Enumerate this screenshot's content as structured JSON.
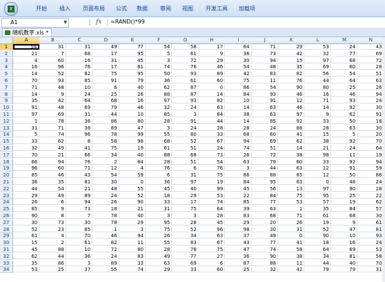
{
  "ribbon": {
    "office_logo": "X",
    "tabs": [
      "开始",
      "插入",
      "页面布局",
      "公式",
      "数据",
      "审阅",
      "视图",
      "开发工具",
      "加载项"
    ]
  },
  "formula_bar": {
    "name_box": "A1",
    "fx": "fx",
    "formula": "=RAND()*99"
  },
  "document": {
    "tab_label": "随机数字.xls *"
  },
  "grid": {
    "columns": [
      "A",
      "B",
      "C",
      "D",
      "E",
      "F",
      "G",
      "H",
      "I",
      "J",
      "K",
      "L",
      "M",
      "N"
    ],
    "rows": [
      [
        54,
        31,
        31,
        49,
        77,
        54,
        58,
        17,
        64,
        71,
        29,
        53,
        24,
        43
      ],
      [
        21,
        7,
        68,
        17,
        95,
        5,
        61,
        9,
        36,
        73,
        42,
        32,
        77,
        69
      ],
      [
        4,
        60,
        16,
        31,
        45,
        3,
        72,
        29,
        30,
        94,
        15,
        97,
        68,
        72
      ],
      [
        16,
        96,
        76,
        17,
        61,
        74,
        76,
        46,
        54,
        48,
        35,
        69,
        60,
        28
      ],
      [
        14,
        52,
        82,
        75,
        95,
        50,
        93,
        89,
        42,
        83,
        82,
        56,
        54,
        51
      ],
      [
        70,
        93,
        85,
        91,
        79,
        36,
        61,
        60,
        75,
        11,
        76,
        44,
        64,
        63
      ],
      [
        71,
        48,
        10,
        6,
        40,
        62,
        87,
        0,
        86,
        54,
        90,
        80,
        25,
        26
      ],
      [
        14,
        9,
        24,
        25,
        26,
        88,
        87,
        14,
        84,
        93,
        46,
        16,
        46,
        94
      ],
      [
        35,
        42,
        64,
        68,
        16,
        97,
        93,
        82,
        10,
        91,
        12,
        71,
        93,
        24
      ],
      [
        91,
        48,
        69,
        79,
        46,
        32,
        24,
        63,
        14,
        63,
        46,
        14,
        92,
        30
      ],
      [
        97,
        69,
        31,
        44,
        10,
        85,
        3,
        84,
        38,
        63,
        97,
        9,
        62,
        91
      ],
      [
        1,
        78,
        36,
        86,
        80,
        28,
        91,
        44,
        14,
        85,
        92,
        33,
        50,
        18
      ],
      [
        31,
        71,
        38,
        89,
        47,
        3,
        24,
        28,
        28,
        24,
        88,
        28,
        63,
        30
      ],
      [
        5,
        74,
        96,
        78,
        99,
        55,
        80,
        33,
        68,
        60,
        41,
        15,
        5,
        20
      ],
      [
        33,
        62,
        8,
        58,
        98,
        68,
        52,
        67,
        94,
        69,
        62,
        38,
        92,
        70
      ],
      [
        32,
        49,
        41,
        75,
        19,
        61,
        51,
        24,
        74,
        51,
        14,
        21,
        24,
        64
      ],
      [
        70,
        21,
        66,
        34,
        40,
        88,
        68,
        73,
        26,
        72,
        38,
        98,
        11,
        19
      ],
      [
        66,
        94,
        76,
        2,
        84,
        28,
        51,
        54,
        63,
        79,
        60,
        33,
        92,
        94
      ],
      [
        96,
        60,
        71,
        12,
        4,
        76,
        6,
        76,
        3,
        44,
        63,
        12,
        91,
        59
      ],
      [
        85,
        46,
        43,
        54,
        59,
        6,
        31,
        75,
        86,
        88,
        85,
        12,
        50,
        86
      ],
      [
        36,
        35,
        81,
        30,
        0,
        36,
        97,
        19,
        84,
        95,
        63,
        0,
        48,
        24
      ],
      [
        44,
        54,
        21,
        48,
        55,
        45,
        40,
        99,
        45,
        56,
        13,
        97,
        90,
        28
      ],
      [
        29,
        49,
        89,
        24,
        52,
        18,
        29,
        53,
        22,
        84,
        75,
        95,
        25,
        22
      ],
      [
        26,
        6,
        94,
        26,
        90,
        33,
        17,
        74,
        85,
        77,
        53,
        57,
        19,
        62
      ],
      [
        85,
        9,
        73,
        18,
        21,
        31,
        75,
        64,
        39,
        63,
        1,
        35,
        84,
        57
      ],
      [
        90,
        8,
        7,
        78,
        40,
        3,
        3,
        28,
        83,
        68,
        71,
        61,
        68,
        30
      ],
      [
        30,
        73,
        30,
        78,
        29,
        95,
        28,
        45,
        29,
        20,
        26,
        19,
        9,
        61
      ],
      [
        52,
        23,
        85,
        1,
        3,
        75,
        52,
        96,
        98,
        30,
        31,
        52,
        47,
        81
      ],
      [
        61,
        4,
        70,
        46,
        94,
        26,
        34,
        63,
        37,
        49,
        0,
        90,
        10,
        93
      ],
      [
        15,
        2,
        61,
        82,
        11,
        55,
        83,
        67,
        43,
        77,
        41,
        18,
        16,
        24
      ],
      [
        45,
        88,
        10,
        72,
        80,
        28,
        78,
        75,
        47,
        74,
        58,
        64,
        69,
        53
      ],
      [
        62,
        44,
        36,
        24,
        83,
        49,
        77,
        27,
        36,
        90,
        38,
        34,
        81,
        58
      ],
      [
        35,
        86,
        3,
        89,
        33,
        63,
        69,
        6,
        87,
        88,
        11,
        44,
        40,
        70
      ],
      [
        53,
        25,
        37,
        55,
        74,
        29,
        33,
        60,
        25,
        32,
        42,
        79,
        79,
        31
      ]
    ]
  }
}
